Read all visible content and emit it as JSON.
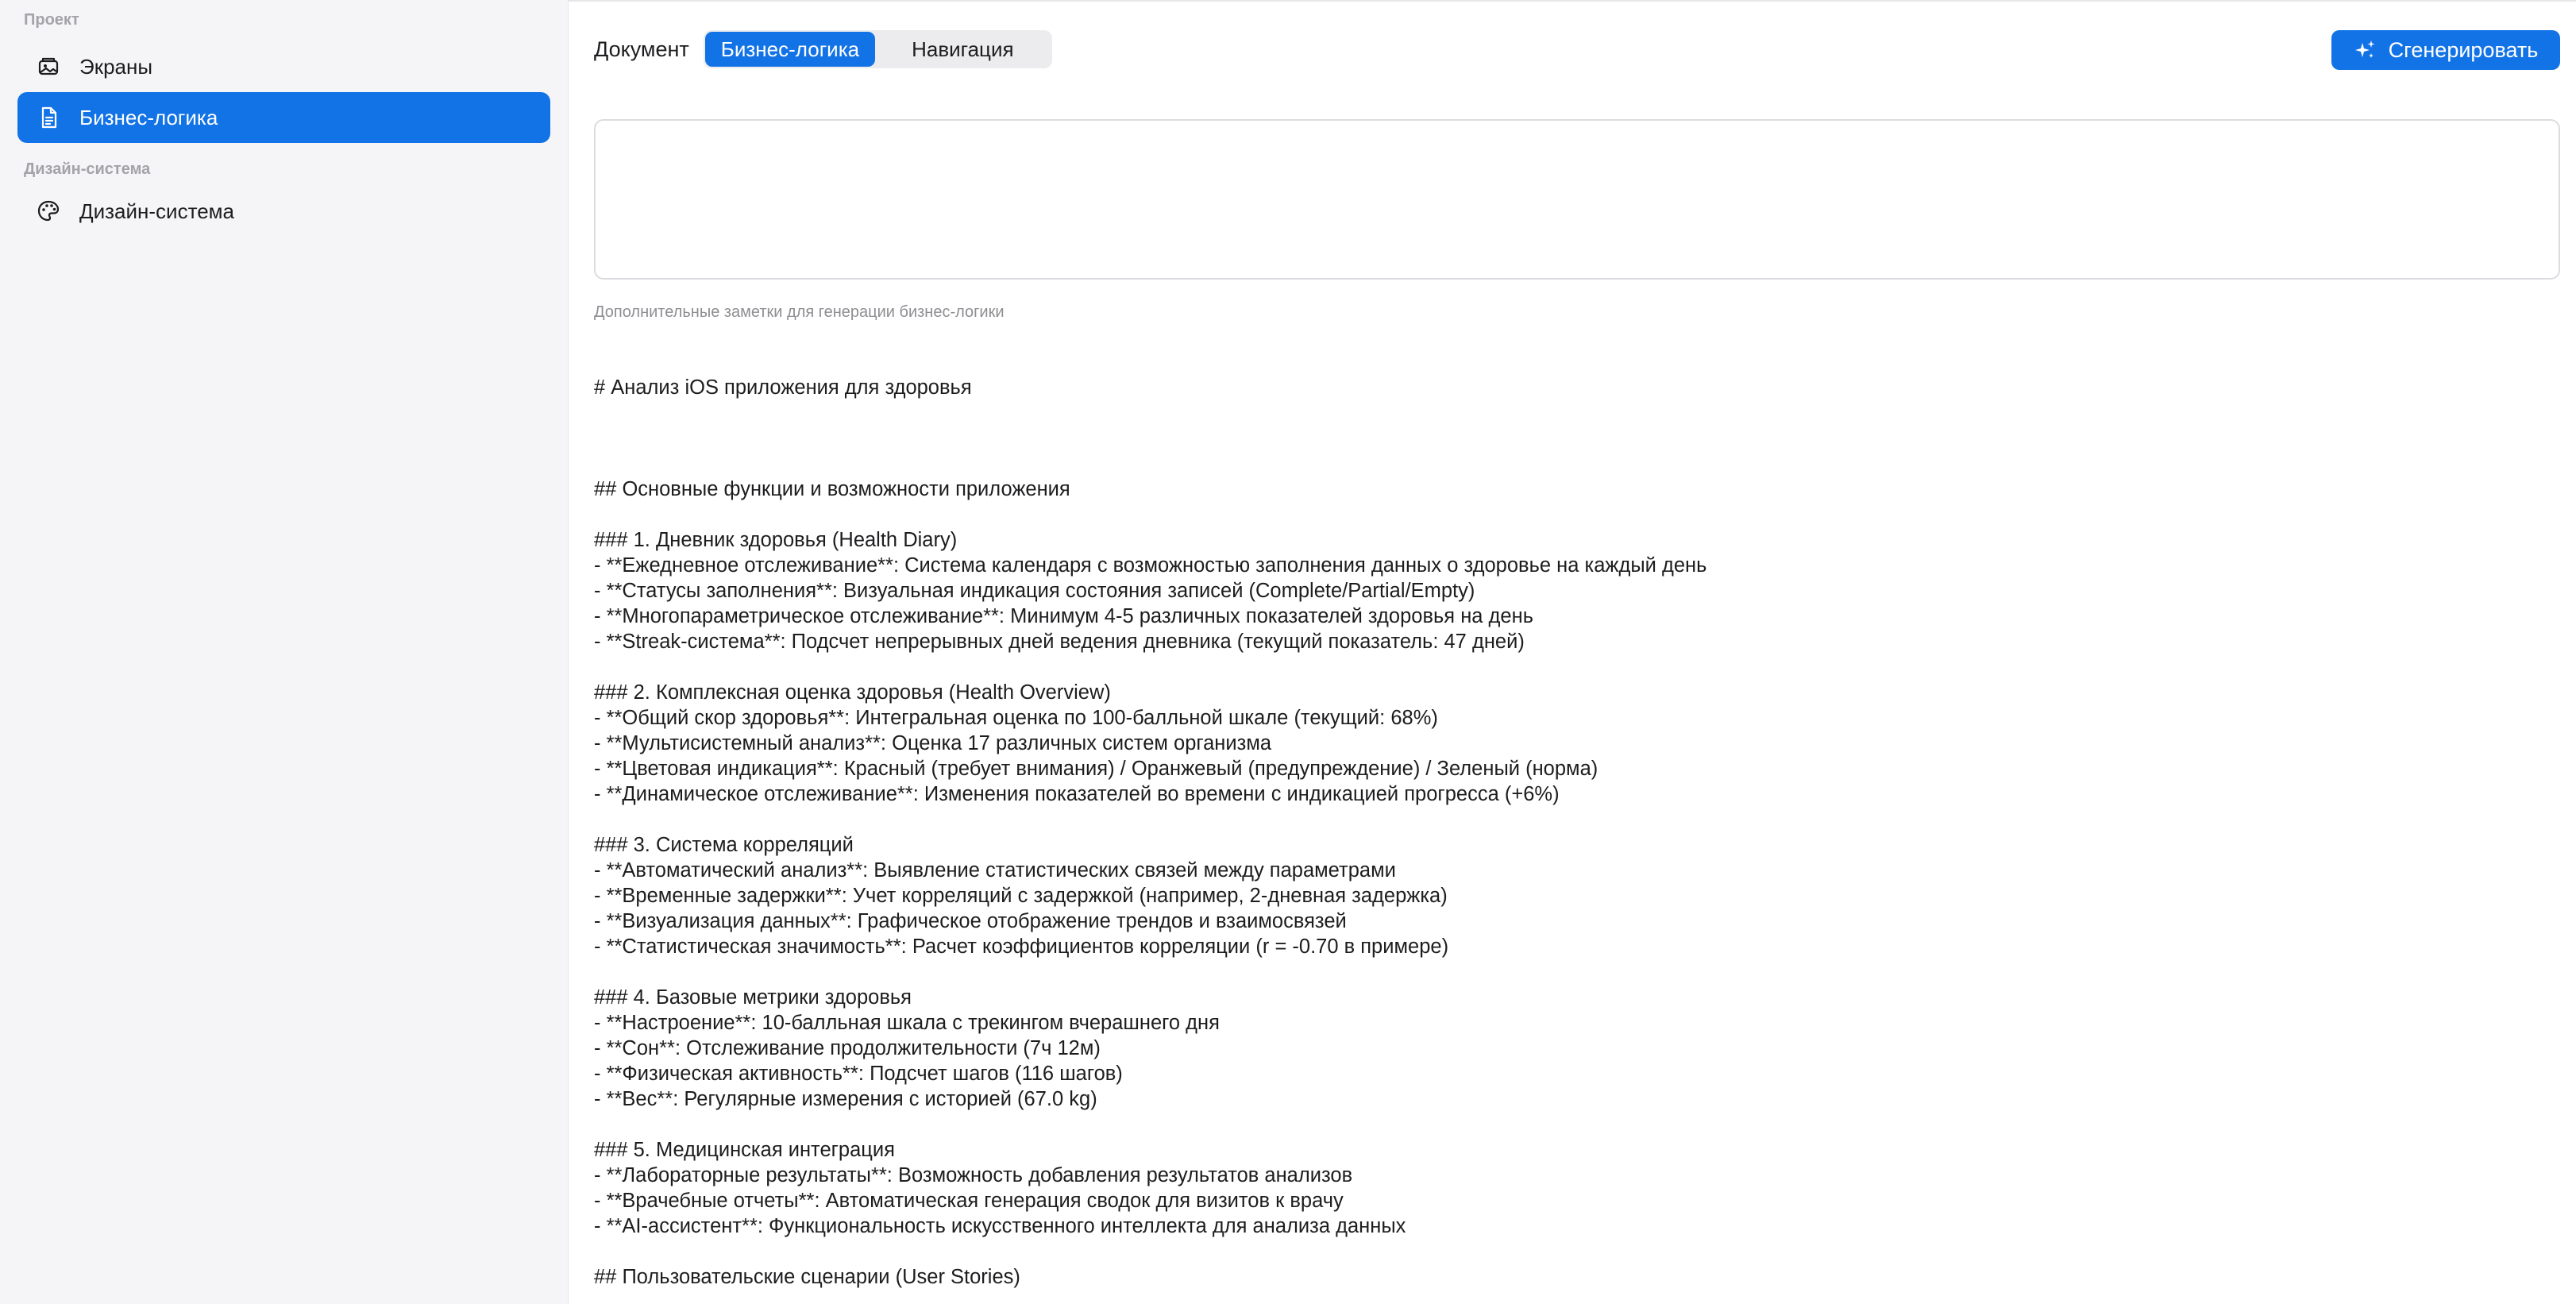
{
  "sidebar": {
    "project_header": "Проект",
    "items": [
      {
        "label": "Экраны",
        "icon": "screens-icon"
      },
      {
        "label": "Бизнес-логика",
        "icon": "document-icon",
        "active": true
      }
    ],
    "design_header": "Дизайн-система",
    "design_items": [
      {
        "label": "Дизайн-система",
        "icon": "palette-icon"
      }
    ]
  },
  "toolbar": {
    "document_label": "Документ",
    "tabs": [
      {
        "label": "Бизнес-логика",
        "active": true
      },
      {
        "label": "Навигация",
        "active": false
      }
    ],
    "generate_label": "Сгенерировать",
    "generate_icon": "sparkles-icon"
  },
  "notes": {
    "value": "",
    "hint": "Дополнительные заметки для генерации бизнес-логики"
  },
  "document": {
    "lines": [
      "# Анализ iOS приложения для здоровья",
      "",
      "",
      "",
      "## Основные функции и возможности приложения",
      "",
      "### 1. Дневник здоровья (Health Diary)",
      "- **Ежедневное отслеживание**: Система календаря с возможностью заполнения данных о здоровье на каждый день",
      "- **Статусы заполнения**: Визуальная индикация состояния записей (Complete/Partial/Empty)",
      "- **Многопараметрическое отслеживание**: Минимум 4-5 различных показателей здоровья на день",
      "- **Streak-система**: Подсчет непрерывных дней ведения дневника (текущий показатель: 47 дней)",
      "",
      "### 2. Комплексная оценка здоровья (Health Overview)",
      "- **Общий скор здоровья**: Интегральная оценка по 100-балльной шкале (текущий: 68%)",
      "- **Мультисистемный анализ**: Оценка 17 различных систем организма",
      "- **Цветовая индикация**: Красный (требует внимания) / Оранжевый (предупреждение) / Зеленый (норма)",
      "- **Динамическое отслеживание**: Изменения показателей во времени с индикацией прогресса (+6%)",
      "",
      "### 3. Система корреляций",
      "- **Автоматический анализ**: Выявление статистических связей между параметрами",
      "- **Временные задержки**: Учет корреляций с задержкой (например, 2-дневная задержка)",
      "- **Визуализация данных**: Графическое отображение трендов и взаимосвязей",
      "- **Статистическая значимость**: Расчет коэффициентов корреляции (r = -0.70 в примере)",
      "",
      "### 4. Базовые метрики здоровья",
      "- **Настроение**: 10-балльная шкала с трекингом вчерашнего дня",
      "- **Сон**: Отслеживание продолжительности (7ч 12м)",
      "- **Физическая активность**: Подсчет шагов (116 шагов)",
      "- **Вес**: Регулярные измерения с историей (67.0 kg)",
      "",
      "### 5. Медицинская интеграция",
      "- **Лабораторные результаты**: Возможность добавления результатов анализов",
      "- **Врачебные отчеты**: Автоматическая генерация сводок для визитов к врачу",
      "- **AI-ассистент**: Функциональность искусственного интеллекта для анализа данных",
      "",
      "## Пользовательские сценарии (User Stories)"
    ]
  },
  "colors": {
    "accent": "#1273e6",
    "sidebar_bg": "#f5f5f7"
  }
}
